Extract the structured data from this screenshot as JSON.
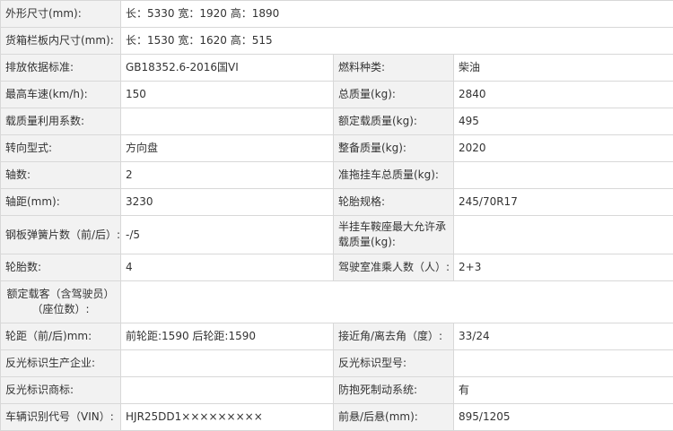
{
  "rows": [
    {
      "label": "外形尺寸(mm):",
      "value": "长：5330 宽：1920 高：1890"
    },
    {
      "label": "货箱栏板内尺寸(mm):",
      "value": "长：1530 宽：1620 高：515"
    },
    {
      "label": "排放依据标准:",
      "value": "GB18352.6-2016国VI",
      "label2": "燃料种类:",
      "value2": "柴油"
    },
    {
      "label": "最高车速(km/h):",
      "value": "150",
      "label2": "总质量(kg):",
      "value2": "2840"
    },
    {
      "label": "载质量利用系数:",
      "value": "",
      "label2": "额定载质量(kg):",
      "value2": "495"
    },
    {
      "label": "转向型式:",
      "value": "方向盘",
      "label2": "整备质量(kg):",
      "value2": "2020"
    },
    {
      "label": "轴数:",
      "value": "2",
      "label2": "准拖挂车总质量(kg):",
      "value2": ""
    },
    {
      "label": "轴距(mm):",
      "value": "3230",
      "label2": "轮胎规格:",
      "value2": "245/70R17"
    },
    {
      "label": "钢板弹簧片数（前/后）:",
      "value": "-/5",
      "label2": "半挂车鞍座最大允许承载质量(kg):",
      "value2": ""
    },
    {
      "label": "轮胎数:",
      "value": "4",
      "label2": "驾驶室准乘人数（人）:",
      "value2": "2+3"
    },
    {
      "label": "额定载客（含驾驶员）（座位数）:",
      "value": ""
    },
    {
      "label": "轮距（前/后)mm:",
      "value": "前轮距:1590 后轮距:1590",
      "label2": "接近角/离去角（度）:",
      "value2": "33/24"
    },
    {
      "label": "反光标识生产企业:",
      "value": "",
      "label2": "反光标识型号:",
      "value2": ""
    },
    {
      "label": "反光标识商标:",
      "value": "",
      "label2": "防抱死制动系统:",
      "value2": "有"
    },
    {
      "label": "车辆识别代号（VIN）:",
      "value": "HJR25DD1×××××××××",
      "label2": "前悬/后悬(mm):",
      "value2": "895/1205"
    }
  ]
}
